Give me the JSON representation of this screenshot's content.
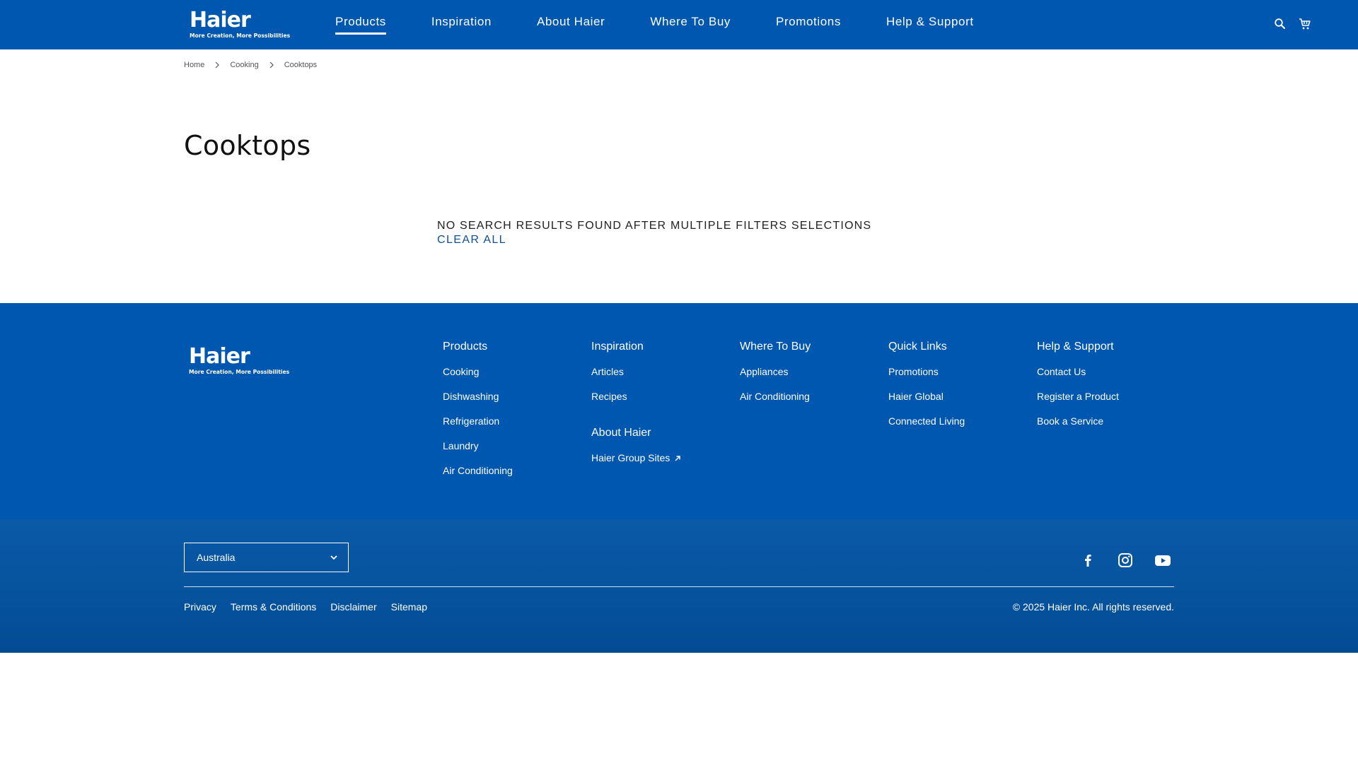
{
  "brand": {
    "name": "Haier",
    "tagline": "More Creation, More Possibilities"
  },
  "header": {
    "nav": [
      {
        "label": "Products",
        "active": true
      },
      {
        "label": "Inspiration",
        "active": false
      },
      {
        "label": "About Haier",
        "active": false
      },
      {
        "label": "Where To Buy",
        "active": false
      },
      {
        "label": "Promotions",
        "active": false
      },
      {
        "label": "Help & Support",
        "active": false
      }
    ],
    "icons": [
      "search-icon",
      "cart-icon"
    ]
  },
  "breadcrumb": [
    "Home",
    "Cooking",
    "Cooktops"
  ],
  "page": {
    "title": "Cooktops",
    "no_results": "NO SEARCH RESULTS FOUND AFTER MULTIPLE FILTERS SELECTIONS",
    "clear_all": "CLEAR ALL"
  },
  "footer": {
    "columns": [
      {
        "title": "Products",
        "links": [
          "Cooking",
          "Dishwashing",
          "Refrigeration",
          "Laundry",
          "Air Conditioning"
        ]
      },
      {
        "title": "Inspiration",
        "links": [
          "Articles",
          "Recipes"
        ],
        "sub_title": "About Haier",
        "sub_links": [
          "Haier Group Sites"
        ]
      },
      {
        "title": "Where To Buy",
        "links": [
          "Appliances",
          "Air Conditioning"
        ]
      },
      {
        "title": "Quick Links",
        "links": [
          "Promotions",
          "Haier Global",
          "Connected Living"
        ]
      },
      {
        "title": "Help & Support",
        "links": [
          "Contact Us",
          "Register a Product",
          "Book a Service"
        ]
      }
    ],
    "country": "Australia",
    "social": [
      "facebook-icon",
      "instagram-icon",
      "youtube-icon"
    ],
    "legal": [
      "Privacy",
      "Terms & Conditions",
      "Disclaimer",
      "Sitemap"
    ],
    "copyright": "© 2025 Haier Inc. All rights reserved."
  },
  "colors": {
    "brand_blue": "#0057b0",
    "footer_bottom": "#034c94",
    "link_blue": "#0f4f99"
  }
}
